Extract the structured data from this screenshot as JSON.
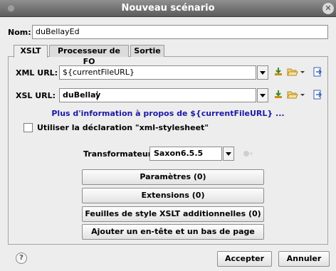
{
  "window": {
    "title": "Nouveau scénario"
  },
  "name": {
    "label": "Nom:",
    "value": "duBellayEd"
  },
  "tabs": [
    {
      "label": "XSLT"
    },
    {
      "label": "Processeur de FO"
    },
    {
      "label": "Sortie"
    }
  ],
  "xml_url": {
    "label": "XML URL:",
    "value": "${currentFileURL}"
  },
  "xsl_url": {
    "label": "XSL URL:",
    "value": "duBellay"
  },
  "info_link": "Plus d'information à propos de ${currentFileURL} ...",
  "stylesheet_checkbox": {
    "label": "Utiliser la déclaration \"xml-stylesheet\"",
    "checked": false
  },
  "transformer": {
    "label": "Transformateur:",
    "value": "Saxon6.5.5"
  },
  "buttons": {
    "parameters": "Paramètres (0)",
    "extensions": "Extensions (0)",
    "additional_xslt": "Feuilles de style XSLT additionnelles (0)",
    "header_footer": "Ajouter un en-tête et un bas de page"
  },
  "footer": {
    "accept": "Accepter",
    "cancel": "Annuler"
  },
  "icons": {
    "help": "help-icon",
    "insert_editor_var": "insert-variable-icon",
    "browse": "folder-open-icon",
    "open_in_editor": "open-editor-icon"
  },
  "colors": {
    "link": "#1a1aa6",
    "titlebar": "#6e6e6e"
  }
}
